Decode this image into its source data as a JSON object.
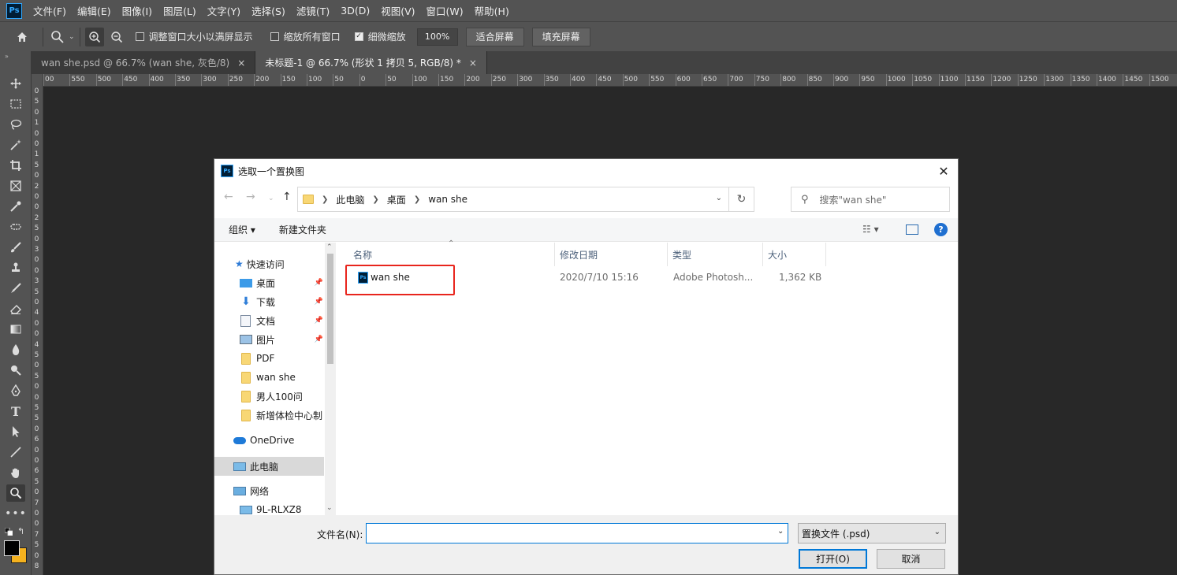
{
  "app": {
    "logo": "Ps",
    "menu": [
      "文件(F)",
      "编辑(E)",
      "图像(I)",
      "图层(L)",
      "文字(Y)",
      "选择(S)",
      "滤镜(T)",
      "3D(D)",
      "视图(V)",
      "窗口(W)",
      "帮助(H)"
    ]
  },
  "options": {
    "chk_resize": "调整窗口大小以满屏显示",
    "chk_all": "缩放所有窗口",
    "chk_scrubby": "细微缩放",
    "zoom_value": "100%",
    "btn_fit": "适合屏幕",
    "btn_fill": "填充屏幕"
  },
  "tabs": [
    {
      "label": "wan she.psd @ 66.7% (wan she, 灰色/8)",
      "close": "×"
    },
    {
      "label": "未标题-1 @ 66.7% (形状 1 拷贝 5, RGB/8) *",
      "close": "×"
    }
  ],
  "ruler": {
    "h_labels": [
      "00",
      "550",
      "500",
      "450",
      "400",
      "350",
      "300",
      "250",
      "200",
      "150",
      "100",
      "50",
      "0",
      "50",
      "100",
      "150",
      "200",
      "250",
      "300",
      "350",
      "400",
      "450",
      "500",
      "550",
      "600",
      "650",
      "700",
      "750",
      "800",
      "850",
      "900",
      "950",
      "1000",
      "1050",
      "1100",
      "1150",
      "1200",
      "1250",
      "1300",
      "1350",
      "1400",
      "1450",
      "1500"
    ],
    "v_labels": [
      "0",
      "5",
      "0",
      "1",
      "0",
      "0",
      "1",
      "5",
      "0",
      "2",
      "0",
      "0",
      "2",
      "5",
      "0",
      "3",
      "0",
      "0",
      "3",
      "5",
      "0",
      "4",
      "0",
      "0",
      "4",
      "5",
      "0",
      "5",
      "0",
      "0",
      "5",
      "5",
      "0",
      "6",
      "0",
      "0",
      "6",
      "5",
      "0",
      "7",
      "0",
      "0",
      "7",
      "5",
      "0",
      "8"
    ]
  },
  "dialog": {
    "title": "选取一个置换图",
    "close": "✕",
    "breadcrumb": [
      "此电脑",
      "桌面",
      "wan she"
    ],
    "search_placeholder": "搜索\"wan she\"",
    "cmd_organize": "组织 ▾",
    "cmd_newfolder": "新建文件夹",
    "nav": {
      "quick_access": "快速访问",
      "items": [
        {
          "label": "桌面",
          "icon": "desktop-icon",
          "pinned": true
        },
        {
          "label": "下载",
          "icon": "download-icon",
          "pinned": true
        },
        {
          "label": "文档",
          "icon": "document-icon",
          "pinned": true
        },
        {
          "label": "图片",
          "icon": "picture-icon",
          "pinned": true
        },
        {
          "label": "PDF",
          "icon": "folder-icon",
          "pinned": false
        },
        {
          "label": "wan she",
          "icon": "folder-icon",
          "pinned": false
        },
        {
          "label": "男人100问",
          "icon": "folder-icon",
          "pinned": false
        },
        {
          "label": "新增体检中心制",
          "icon": "folder-icon",
          "pinned": false
        }
      ],
      "onedrive": "OneDrive",
      "this_pc": "此电脑",
      "network": "网络",
      "network_child": "9L-RLXZ8"
    },
    "columns": [
      "名称",
      "修改日期",
      "类型",
      "大小"
    ],
    "files": [
      {
        "name": "wan she",
        "modified": "2020/7/10 15:16",
        "type": "Adobe Photosh...",
        "size": "1,362 KB"
      }
    ],
    "filename_label": "文件名(N):",
    "filename_value": "",
    "filetype": "置换文件 (.psd)",
    "btn_open": "打开(O)",
    "btn_cancel": "取消"
  }
}
